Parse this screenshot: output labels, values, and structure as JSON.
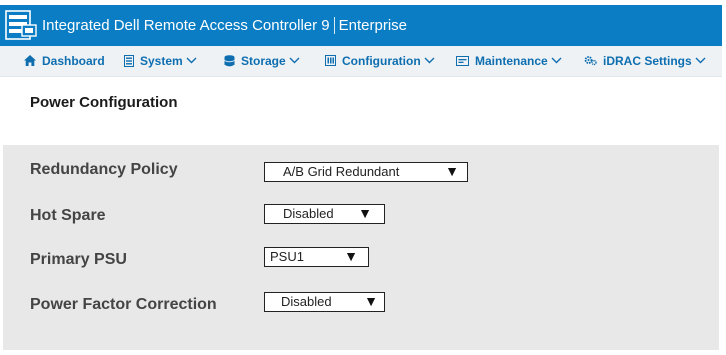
{
  "header": {
    "app_title": "Integrated Dell Remote Access Controller 9",
    "edition": "Enterprise",
    "colors": {
      "header_bg": "#0b7dc4",
      "nav_bg": "#eef2f5",
      "nav_text": "#0e6eb0",
      "panel_bg": "#e8e8e8"
    }
  },
  "nav": {
    "items": [
      {
        "label": "Dashboard",
        "icon": "home-icon"
      },
      {
        "label": "System",
        "icon": "server-icon"
      },
      {
        "label": "Storage",
        "icon": "database-icon"
      },
      {
        "label": "Configuration",
        "icon": "configuration-icon"
      },
      {
        "label": "Maintenance",
        "icon": "maintenance-icon"
      },
      {
        "label": "iDRAC Settings",
        "icon": "gears-icon"
      }
    ]
  },
  "page": {
    "title": "Power Configuration"
  },
  "form": {
    "fields": [
      {
        "label": "Redundancy Policy",
        "value": "A/B Grid Redundant"
      },
      {
        "label": "Hot Spare",
        "value": "Disabled"
      },
      {
        "label": "Primary PSU",
        "value": "PSU1"
      },
      {
        "label": "Power Factor Correction",
        "value": "Disabled"
      }
    ],
    "dropdown_arrow": "▼"
  }
}
